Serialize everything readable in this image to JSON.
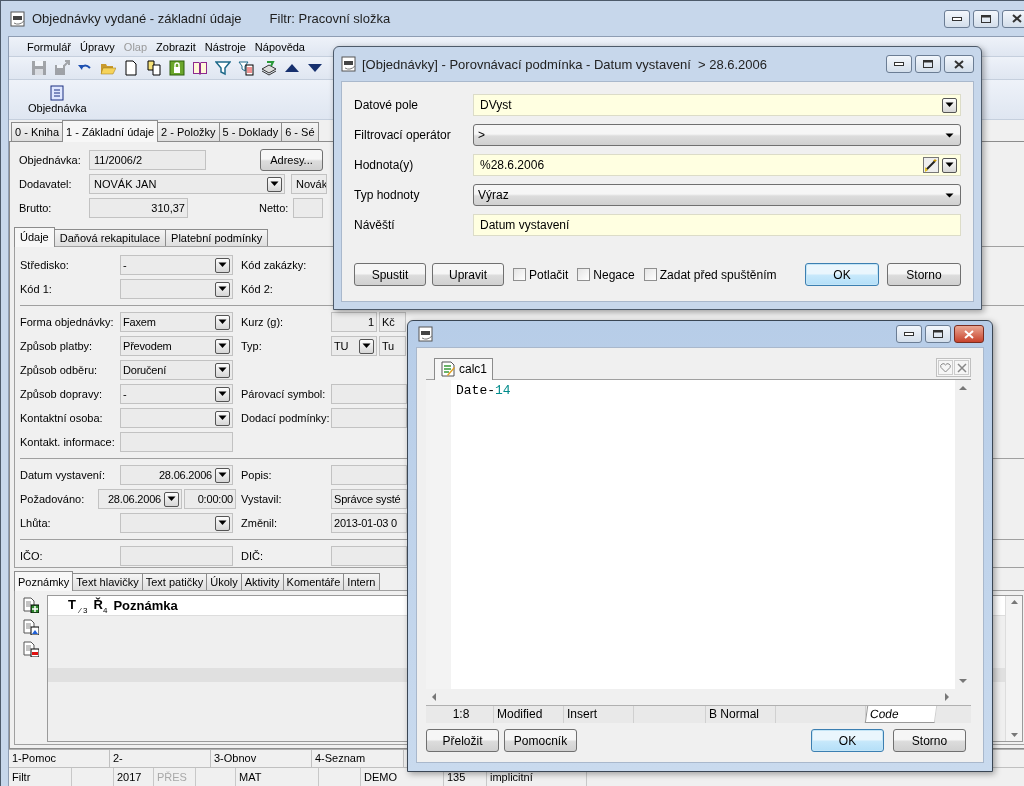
{
  "main_window": {
    "title": "Objednávky vydané - základní údaje",
    "filter": "Filtr: Pracovní složka"
  },
  "menu": [
    {
      "label": "Formulář",
      "disabled": false
    },
    {
      "label": "Úpravy",
      "disabled": false
    },
    {
      "label": "Olap",
      "disabled": true
    },
    {
      "label": "Zobrazit",
      "disabled": false
    },
    {
      "label": "Nástroje",
      "disabled": false
    },
    {
      "label": "Nápověda",
      "disabled": false
    }
  ],
  "toolbar": [
    {
      "kind": "save",
      "disabled": true
    },
    {
      "kind": "save-export",
      "disabled": true
    },
    {
      "kind": "undo",
      "disabled": false
    },
    {
      "kind": "open",
      "disabled": false
    },
    {
      "kind": "new",
      "disabled": false
    },
    {
      "kind": "copy",
      "disabled": false
    },
    {
      "kind": "lock",
      "disabled": false
    },
    {
      "kind": "book",
      "disabled": false
    },
    {
      "kind": "filter",
      "disabled": false
    },
    {
      "kind": "filter-list",
      "disabled": false
    },
    {
      "kind": "stack",
      "disabled": false
    },
    {
      "kind": "up",
      "disabled": false
    },
    {
      "kind": "down",
      "disabled": false
    }
  ],
  "ribbon_button": {
    "label": "Objednávka"
  },
  "main_tabs": [
    {
      "label": "0 - Kniha",
      "selected": false
    },
    {
      "label": "1 - Základní údaje",
      "selected": true
    },
    {
      "label": "2 - Položky",
      "selected": false
    },
    {
      "label": "5 - Doklady",
      "selected": false
    },
    {
      "label": "6 - Sé",
      "selected": false
    }
  ],
  "header": {
    "order_label": "Objednávka:",
    "order_value": "11/2006/2",
    "addresses_button": "Adresy...",
    "supplier_label": "Dodavatel:",
    "supplier_value": "NOVÁK JAN",
    "supplier_name": "Novák",
    "gross_label": "Brutto:",
    "gross_value": "310,37",
    "net_label": "Netto:"
  },
  "detail_tabs": [
    {
      "label": "Údaje",
      "selected": true
    },
    {
      "label": "Daňová rekapitulace",
      "selected": false
    },
    {
      "label": "Platební podmínky",
      "selected": false
    }
  ],
  "form_sections": [
    [
      {
        "left": {
          "label": "Středisko:",
          "fields": [
            {
              "kind": "combo",
              "value": "-"
            }
          ]
        },
        "right": {
          "label": "Kód zakázky:"
        }
      },
      {
        "left": {
          "label": "Kód 1:",
          "fields": [
            {
              "kind": "combo"
            }
          ]
        },
        "right": {
          "label": "Kód 2:"
        }
      }
    ],
    [
      {
        "left": {
          "label": "Forma objednávky:",
          "fields": [
            {
              "kind": "combo",
              "value": "Faxem"
            }
          ]
        },
        "right": {
          "label": "Kurz (g):",
          "fields": [
            {
              "kind": "number",
              "value": "1"
            },
            {
              "kind": "text",
              "value": "Kč"
            }
          ]
        }
      },
      {
        "left": {
          "label": "Způsob platby:",
          "fields": [
            {
              "kind": "combo",
              "value": "Převodem"
            }
          ]
        },
        "right": {
          "label": "Typ:",
          "fields": [
            {
              "kind": "combo",
              "value": "TU"
            },
            {
              "kind": "text",
              "value": "Tu"
            }
          ]
        }
      },
      {
        "left": {
          "label": "Způsob odběru:",
          "fields": [
            {
              "kind": "combo",
              "value": "Doručení"
            }
          ]
        }
      },
      {
        "left": {
          "label": "Způsob dopravy:",
          "fields": [
            {
              "kind": "combo",
              "value": "-"
            }
          ]
        },
        "right": {
          "label": "Párovací symbol:",
          "fields": [
            {
              "kind": "text"
            }
          ]
        }
      },
      {
        "left": {
          "label": "Kontaktní osoba:",
          "fields": [
            {
              "kind": "combo"
            }
          ]
        },
        "right": {
          "label": "Dodací podmínky:",
          "fields": [
            {
              "kind": "text"
            }
          ]
        }
      },
      {
        "left": {
          "label": "Kontakt. informace:",
          "fields": [
            {
              "kind": "text"
            }
          ]
        }
      }
    ],
    [
      {
        "left": {
          "label": "Datum vystavení:",
          "fields": [
            {
              "kind": "date",
              "value": "28.06.2006"
            }
          ]
        },
        "right": {
          "label": "Popis:",
          "fields": [
            {
              "kind": "text"
            }
          ]
        }
      },
      {
        "left": {
          "label": "Požadováno:",
          "fields": [
            {
              "kind": "date",
              "value": "28.06.2006"
            },
            {
              "kind": "time",
              "value": "0:00:00"
            }
          ]
        },
        "right": {
          "label": "Vystavil:",
          "fields": [
            {
              "kind": "text",
              "value": "Správce systé"
            }
          ]
        }
      },
      {
        "left": {
          "label": "Lhůta:",
          "fields": [
            {
              "kind": "combo"
            }
          ]
        },
        "right": {
          "label": "Změnil:",
          "fields": [
            {
              "kind": "text",
              "value": "2013-01-03 0"
            }
          ]
        }
      }
    ],
    [
      {
        "left": {
          "label": "IČO:",
          "fields": [
            {
              "kind": "text"
            }
          ]
        },
        "right": {
          "label": "DIČ:",
          "fields": [
            {
              "kind": "text"
            }
          ]
        }
      }
    ]
  ],
  "notes_tabs": [
    {
      "label": "Poznámky",
      "selected": true
    },
    {
      "label": "Text hlavičky",
      "selected": false
    },
    {
      "label": "Text patičky",
      "selected": false
    },
    {
      "label": "Úkoly",
      "selected": false
    },
    {
      "label": "Aktivity",
      "selected": false
    },
    {
      "label": "Komentáře",
      "selected": false
    },
    {
      "label": "Intern",
      "selected": false
    }
  ],
  "notes_table": {
    "columns": [
      "T $_{⁄ 3}$",
      "Ř$_{4}$",
      "Poznámka"
    ]
  },
  "function_keys": [
    "1-Pomoc",
    "2-",
    "3-Obnov",
    "4-Seznam"
  ],
  "status_bar": [
    {
      "kind": "text",
      "text": "Filtr",
      "disabled": false
    },
    {
      "kind": "empty"
    },
    {
      "kind": "text",
      "text": "2017",
      "disabled": false
    },
    {
      "kind": "text",
      "text": "PŘES",
      "disabled": true
    },
    {
      "kind": "empty"
    },
    {
      "kind": "text",
      "text": "MAT",
      "disabled": false
    },
    {
      "kind": "empty"
    },
    {
      "kind": "text",
      "text": "DEMO",
      "disabled": false
    },
    {
      "kind": "text",
      "text": "135",
      "disabled": false
    },
    {
      "kind": "text",
      "text": "implicitní",
      "disabled": false
    }
  ],
  "filter_dialog": {
    "title": "[Objednávky] - Porovnávací podmínka - Datum vystavení  > 28.6.2006",
    "rows": [
      {
        "label": "Datové pole",
        "kind": "combo",
        "value": "DVyst"
      },
      {
        "label": "Filtrovací operátor",
        "kind": "dropdown",
        "value": ">"
      },
      {
        "label": "Hodnota(y)",
        "kind": "value",
        "value": "%28.6.2006"
      },
      {
        "label": "Typ hodnoty",
        "kind": "dropdown",
        "value": "Výraz"
      },
      {
        "label": "Návěští",
        "kind": "text",
        "value": "Datum vystavení"
      }
    ],
    "buttons": [
      "Spustit",
      "Upravit"
    ],
    "checkboxes": [
      {
        "label": "Potlačit",
        "checked": false
      },
      {
        "label": "Negace",
        "checked": false
      },
      {
        "label": "Zadat před spuštěním",
        "checked": false
      }
    ],
    "ok": "OK",
    "cancel": "Storno"
  },
  "calc_dialog": {
    "tabs": [
      {
        "label": "calc1",
        "selected": true
      }
    ],
    "code": [
      {
        "kind": "plain",
        "text": "Date-"
      },
      {
        "kind": "number",
        "text": "14"
      }
    ],
    "status": [
      {
        "kind": "text",
        "text": "1:8"
      },
      {
        "kind": "text",
        "text": "Modified"
      },
      {
        "kind": "text",
        "text": "Insert"
      },
      {
        "kind": "empty"
      },
      {
        "kind": "text",
        "text": "B Normal"
      },
      {
        "kind": "empty"
      }
    ],
    "view_tab": "Code",
    "buttons": [
      "Přeložit",
      "Pomocník"
    ],
    "ok": "OK",
    "cancel": "Storno"
  }
}
